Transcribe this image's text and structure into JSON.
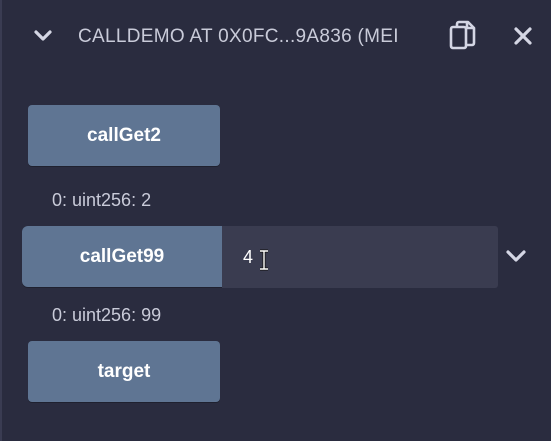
{
  "header": {
    "title": "CALLDEMO AT 0X0FC...9A836 (MEI",
    "collapse_icon": "chevron-down-icon",
    "copy_icon": "copy-icon",
    "close_icon": "close-icon"
  },
  "functions": [
    {
      "label": "callGet2",
      "output": "0: uint256: 2"
    },
    {
      "label": "callGet99",
      "output": "0: uint256: 99",
      "input_value": "4"
    },
    {
      "label": "target"
    }
  ],
  "colors": {
    "background": "#2a2c3f",
    "button": "#5f7593",
    "input_bg": "#3a3c50",
    "text": "#c9cbd9"
  }
}
